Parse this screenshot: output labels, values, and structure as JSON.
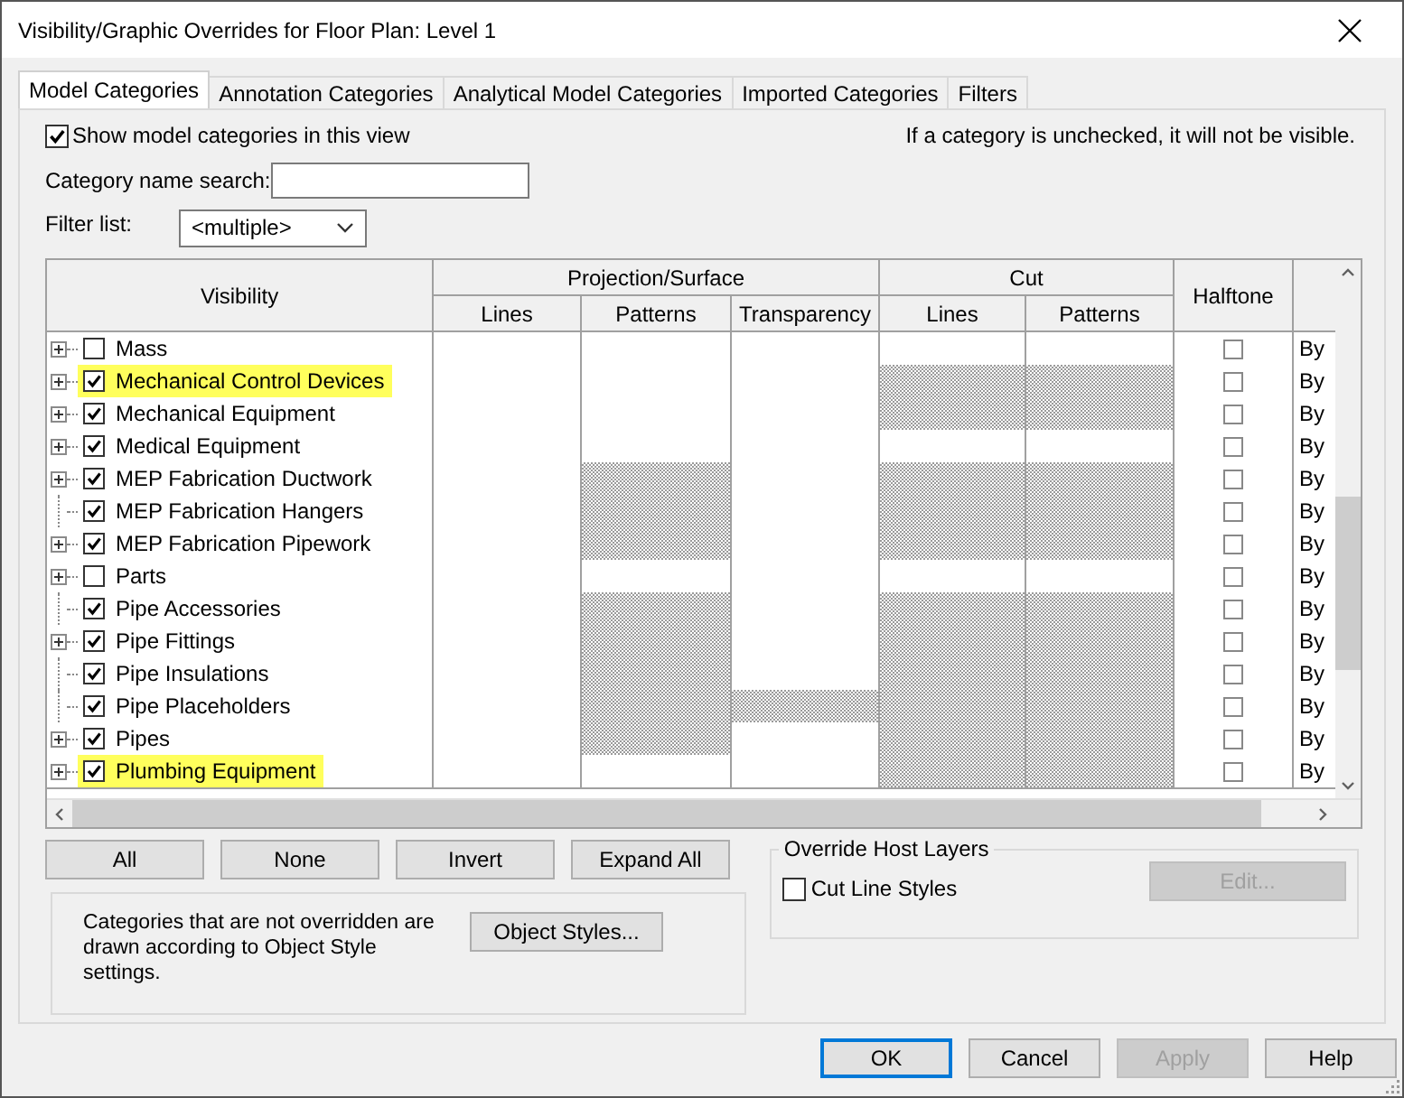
{
  "window": {
    "title": "Visibility/Graphic Overrides for Floor Plan: Level 1"
  },
  "tabs": [
    {
      "label": "Model Categories",
      "selected": true
    },
    {
      "label": "Annotation Categories",
      "selected": false
    },
    {
      "label": "Analytical Model Categories",
      "selected": false
    },
    {
      "label": "Imported Categories",
      "selected": false
    },
    {
      "label": "Filters",
      "selected": false
    }
  ],
  "show_categories": {
    "label": "Show model categories in this view",
    "checked": true
  },
  "hint": "If a category is unchecked, it will not be visible.",
  "search": {
    "label": "Category name search:"
  },
  "filter": {
    "label": "Filter list:",
    "value": "<multiple>"
  },
  "table": {
    "visibility": "Visibility",
    "projection": {
      "label": "Projection/Surface",
      "columns": [
        "Lines",
        "Patterns",
        "Transparency"
      ]
    },
    "cut": {
      "label": "Cut",
      "columns": [
        "Lines",
        "Patterns"
      ]
    },
    "halftone": "Halftone",
    "rows": [
      {
        "name": "Mass",
        "expandable": true,
        "checked": false,
        "highlighted": false,
        "shaded": [
          false,
          false,
          false,
          false,
          false
        ],
        "halftone": false,
        "column_8": "By"
      },
      {
        "name": "Mechanical Control Devices",
        "expandable": true,
        "checked": true,
        "highlighted": true,
        "shaded": [
          false,
          false,
          false,
          true,
          true
        ],
        "halftone": false,
        "column_8": "By"
      },
      {
        "name": "Mechanical Equipment",
        "expandable": true,
        "checked": true,
        "highlighted": false,
        "shaded": [
          false,
          false,
          false,
          true,
          true
        ],
        "halftone": false,
        "column_8": "By"
      },
      {
        "name": "Medical Equipment",
        "expandable": true,
        "checked": true,
        "highlighted": false,
        "shaded": [
          false,
          false,
          false,
          false,
          false
        ],
        "halftone": false,
        "column_8": "By"
      },
      {
        "name": "MEP Fabrication Ductwork",
        "expandable": true,
        "checked": true,
        "highlighted": false,
        "shaded": [
          false,
          true,
          false,
          true,
          true
        ],
        "halftone": false,
        "column_8": "By"
      },
      {
        "name": "MEP Fabrication Hangers",
        "expandable": false,
        "checked": true,
        "highlighted": false,
        "shaded": [
          false,
          true,
          false,
          true,
          true
        ],
        "halftone": false,
        "column_8": "By"
      },
      {
        "name": "MEP Fabrication Pipework",
        "expandable": true,
        "checked": true,
        "highlighted": false,
        "shaded": [
          false,
          true,
          false,
          true,
          true
        ],
        "halftone": false,
        "column_8": "By"
      },
      {
        "name": "Parts",
        "expandable": true,
        "checked": false,
        "highlighted": false,
        "shaded": [
          false,
          false,
          false,
          false,
          false
        ],
        "halftone": false,
        "column_8": "By"
      },
      {
        "name": "Pipe Accessories",
        "expandable": false,
        "checked": true,
        "highlighted": false,
        "shaded": [
          false,
          true,
          false,
          true,
          true
        ],
        "halftone": false,
        "column_8": "By"
      },
      {
        "name": "Pipe Fittings",
        "expandable": true,
        "checked": true,
        "highlighted": false,
        "shaded": [
          false,
          true,
          false,
          true,
          true
        ],
        "halftone": false,
        "column_8": "By"
      },
      {
        "name": "Pipe Insulations",
        "expandable": false,
        "checked": true,
        "highlighted": false,
        "shaded": [
          false,
          true,
          false,
          true,
          true
        ],
        "halftone": false,
        "column_8": "By"
      },
      {
        "name": "Pipe Placeholders",
        "expandable": false,
        "checked": true,
        "highlighted": false,
        "shaded": [
          false,
          true,
          true,
          true,
          true
        ],
        "halftone": false,
        "column_8": "By"
      },
      {
        "name": "Pipes",
        "expandable": true,
        "checked": true,
        "highlighted": false,
        "shaded": [
          false,
          true,
          false,
          true,
          true
        ],
        "halftone": false,
        "column_8": "By"
      },
      {
        "name": "Plumbing Equipment",
        "expandable": true,
        "checked": true,
        "highlighted": true,
        "shaded": [
          false,
          false,
          false,
          true,
          true
        ],
        "halftone": false,
        "column_8": "By"
      }
    ]
  },
  "buttons": [
    "All",
    "None",
    "Invert",
    "Expand All"
  ],
  "info": {
    "text": "Categories that are not overridden are drawn according to Object Style settings.",
    "button": "Object Styles..."
  },
  "override_host_layers": {
    "title": "Override Host Layers",
    "cut_line_styles": {
      "label": "Cut Line Styles",
      "checked": false
    },
    "edit_button": {
      "label": "Edit...",
      "disabled": true
    }
  },
  "footer_buttons": [
    {
      "label": "OK",
      "default": true,
      "disabled": false
    },
    {
      "label": "Cancel",
      "default": false,
      "disabled": false
    },
    {
      "label": "Apply",
      "default": false,
      "disabled": true
    },
    {
      "label": "Help",
      "default": false,
      "disabled": false
    }
  ]
}
